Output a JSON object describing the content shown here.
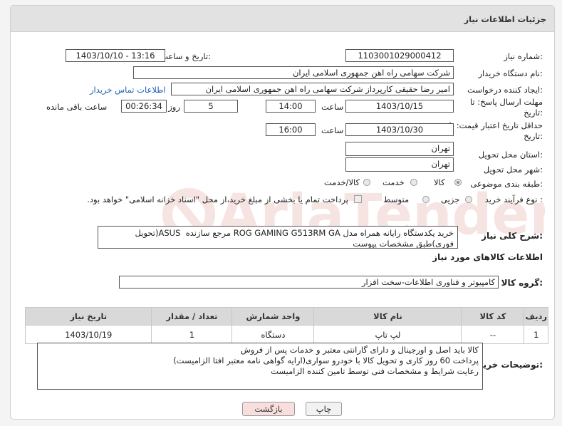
{
  "header": {
    "title": "جزئیات اطلاعات نیاز"
  },
  "need_number": {
    "label": "شماره نیاز:",
    "value": "1103001029000412"
  },
  "announce_datetime": {
    "label": "تاریخ و ساعت اعلان عمومی:",
    "value": "1403/10/10 - 13:16"
  },
  "buyer_org": {
    "label": "نام دستگاه خریدار:",
    "value": "شرکت سهامی راه اهن جمهوری اسلامی ایران"
  },
  "requester": {
    "label": "ایجاد کننده درخواست:",
    "value": "امیر رضا  حقیقی کارپرداز شرکت سهامی راه اهن جمهوری اسلامی ایران",
    "contact_link": "اطلاعات تماس خریدار"
  },
  "response_deadline": {
    "label_line1": "مهلت ارسال پاسخ: تا",
    "label_line2": "تاریخ:",
    "date": "1403/10/15",
    "time_label": "ساعت",
    "time": "14:00",
    "days": "5",
    "days_label": "روز و",
    "remaining": "00:26:34",
    "remaining_label": "ساعت باقی مانده"
  },
  "price_validity": {
    "label_line1": "حداقل تاریخ اعتبار قیمت: تا",
    "label_line2": "تاریخ:",
    "date": "1403/10/30",
    "time_label": "ساعت",
    "time": "16:00"
  },
  "delivery_province": {
    "label": "استان محل تحویل:",
    "value": "تهران"
  },
  "delivery_city": {
    "label": "شهر محل تحویل:",
    "value": "تهران"
  },
  "category": {
    "label": "طبقه بندی موضوعی:",
    "options": [
      "کالا",
      "خدمت",
      "کالا/خدمت"
    ],
    "selected": "کالا"
  },
  "purchase_process": {
    "label": "نوع فرآیند خرید :",
    "options": [
      "جزیی",
      "متوسط"
    ],
    "selected": "",
    "checkbox_text": "پرداخت تمام یا بخشی از مبلغ خرید،از محل \"اسناد خزانه اسلامی\" خواهد بود."
  },
  "general_description": {
    "label": "شرح کلی نیاز:",
    "value": "خرید یکدستگاه رایانه همراه مدل ROG GAMING G513RM GA مرجع سازنده  ASUS(تحویل فوری)طبق مشخصات پیوست"
  },
  "goods_info": {
    "title": "اطلاعات کالاهای مورد نیاز"
  },
  "goods_group": {
    "label": "گروه کالا:",
    "value": "کامپیوتر و فناوری اطلاعات-سخت افزار"
  },
  "goods_table": {
    "headers": [
      "ردیف",
      "کد کالا",
      "نام کالا",
      "واحد شمارش",
      "تعداد / مقدار",
      "تاریخ نیاز"
    ],
    "rows": [
      [
        "1",
        "--",
        "لپ تاپ",
        "دستگاه",
        "1",
        "1403/10/19"
      ]
    ]
  },
  "buyer_notes": {
    "label": "توضیحات خریدار:",
    "value": "کالا باید اصل و اورجینال و دارای گارانتی معتبر و خدمات پس از فروش\nپرداخت 60 روز کاری و تحویل کالا با خودرو سواری(ارایه گواهی نامه معتبر افتا الزامیست)\nرعایت شرایط و مشخصات فنی توسط تامین کننده الزامیست"
  },
  "buttons": {
    "print": "چاپ",
    "back": "بازگشت"
  },
  "watermark_text": "AriaTender.neT",
  "colors": {
    "header_bg": "#e2e2e2",
    "link": "#1a5fb4",
    "back_button_bg": "#f9dede",
    "watermark": "#c0392b"
  }
}
